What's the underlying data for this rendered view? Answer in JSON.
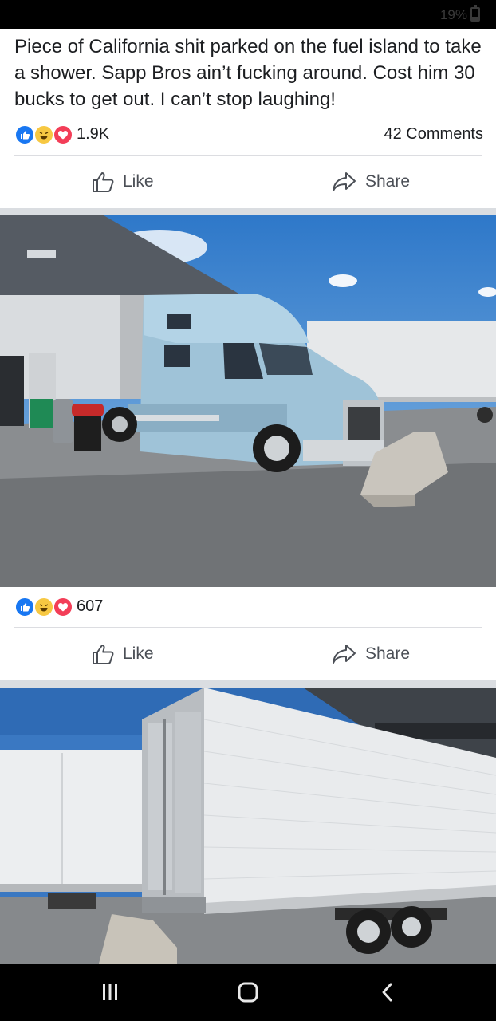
{
  "status_bar": {
    "battery": "19%"
  },
  "post": {
    "text": "Piece of California shit parked on the fuel island to take a shower. Sapp Bros ain’t fucking around. Cost him 30 bucks to get out. I can’t stop laughing!",
    "reaction_count": "1.9K",
    "comments_label": "42 Comments",
    "reaction_icons": [
      "like-icon",
      "haha-icon",
      "love-icon"
    ]
  },
  "actions": {
    "like_label": "Like",
    "share_label": "Share"
  },
  "photo1": {
    "reaction_count": "607",
    "reaction_icons": [
      "like-icon",
      "haha-icon",
      "love-icon"
    ]
  },
  "photo1_actions": {
    "like_label": "Like",
    "share_label": "Share"
  },
  "nav": {
    "icons": [
      "recent-apps-icon",
      "home-icon",
      "back-icon"
    ]
  },
  "colors": {
    "facebook_blue": "#1877f2",
    "haha_yellow": "#f7c842",
    "love_red": "#f33e58",
    "truck_blue": "#9fc3d8"
  }
}
